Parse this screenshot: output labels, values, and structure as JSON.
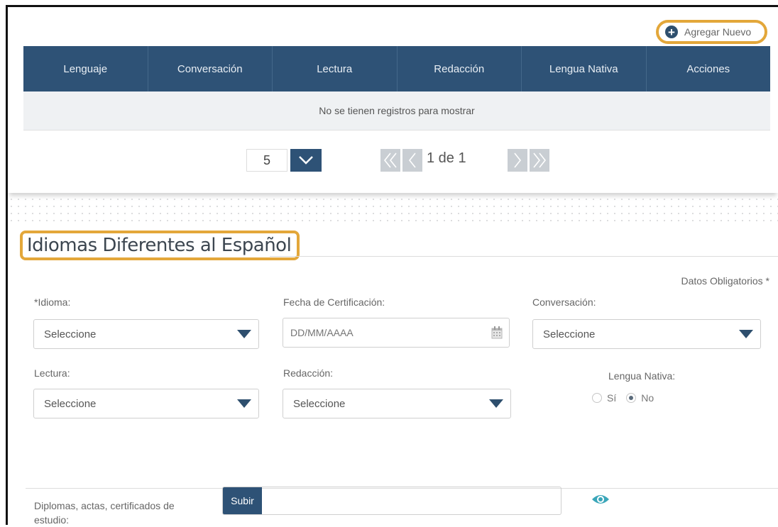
{
  "actions": {
    "add_label": "Agregar Nuevo"
  },
  "table": {
    "columns": [
      "Lenguaje",
      "Conversación",
      "Lectura",
      "Redacción",
      "Lengua Nativa",
      "Acciones"
    ],
    "empty_message": "No se tienen registros para mostrar"
  },
  "pagination": {
    "page_size": "5",
    "page_label": "1 de 1"
  },
  "section": {
    "title": "Idiomas Diferentes al Español",
    "required_note": "Datos Obligatorios *"
  },
  "form": {
    "idioma_label": "*Idioma:",
    "idioma_value": "Seleccione",
    "fecha_label": "Fecha de Certificación:",
    "fecha_placeholder": "DD/MM/AAAA",
    "conversacion_label": "Conversación:",
    "conversacion_value": "Seleccione",
    "lectura_label": "Lectura:",
    "lectura_value": "Seleccione",
    "redaccion_label": "Redacción:",
    "redaccion_value": "Seleccione",
    "lengua_nativa_label": "Lengua Nativa:",
    "radio_si": "Sí",
    "radio_no": "No",
    "radio_selected": "No"
  },
  "upload": {
    "label": "Diplomas, actas, certificados de estudio:",
    "button_label": "Subir"
  },
  "colors": {
    "header_blue": "#2e5276",
    "highlight_orange": "#e3a73a",
    "eye_teal": "#3aa6b9"
  }
}
